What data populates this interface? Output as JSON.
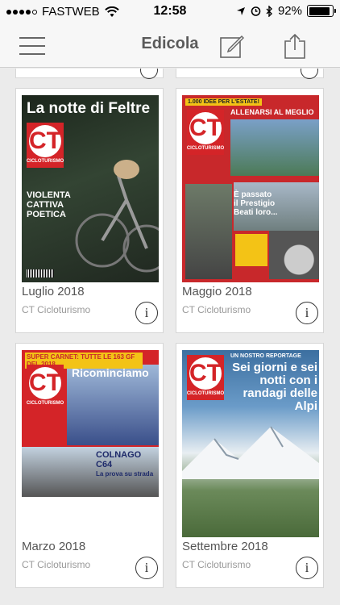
{
  "status_bar": {
    "carrier": "FASTWEB",
    "time": "12:58",
    "battery": "92%",
    "battery_level": 0.92
  },
  "nav": {
    "title": "Edicola",
    "menu_icon": "hamburger-menu-icon",
    "edit_icon": "compose-icon",
    "share_icon": "share-icon"
  },
  "issues": [
    {
      "title": "Luglio 2018",
      "publisher": "CT Cicloturismo",
      "cover_headline": "La notte di Feltre",
      "cover_lines": [
        "VIOLENTA",
        "CATTIVA",
        "POETICA"
      ],
      "cover_color": "#2a3a2a"
    },
    {
      "title": "Maggio 2018",
      "publisher": "CT Cicloturismo",
      "cover_headline": "ALLENARSI AL MEGLIO",
      "cover_lines": [
        "È passato",
        "il Prestigio",
        "Beati loro..."
      ],
      "cover_color": "#c8282b"
    },
    {
      "title": "Marzo 2018",
      "publisher": "CT Cicloturismo",
      "cover_headline": "SUPER CARNET: TUTTE LE 163 GF DEL 2018",
      "cover_lines": [
        "Ricominciamo",
        "COLNAGO C64",
        "La prova su strada"
      ],
      "cover_color": "#d42428"
    },
    {
      "title": "Settembre 2018",
      "publisher": "CT Cicloturismo",
      "cover_headline": "Sei giorni e sei notti con i randagi delle Alpi",
      "cover_lines": [
        "UN NOSTRO REPORTAGE"
      ],
      "cover_color": "#3c6fa0"
    }
  ],
  "info_label": "i",
  "logo_text": "CICLOTURISMO",
  "logo_letter": "CT"
}
